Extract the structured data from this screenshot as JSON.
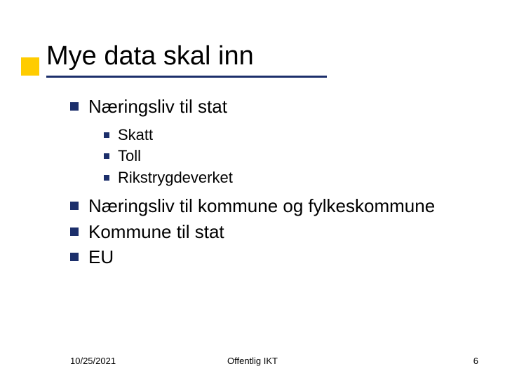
{
  "accent_color": "#ffcc00",
  "underline_color": "#1c2f6b",
  "title": "Mye data skal inn",
  "bullets": {
    "b1": "Næringsliv til stat",
    "b1_sub": {
      "s1": "Skatt",
      "s2": "Toll",
      "s3": "Rikstrygdeverket"
    },
    "b2": "Næringsliv til kommune og fylkeskommune",
    "b3": "Kommune til stat",
    "b4": "EU"
  },
  "footer": {
    "date": "10/25/2021",
    "center": "Offentlig IKT",
    "page": "6"
  }
}
